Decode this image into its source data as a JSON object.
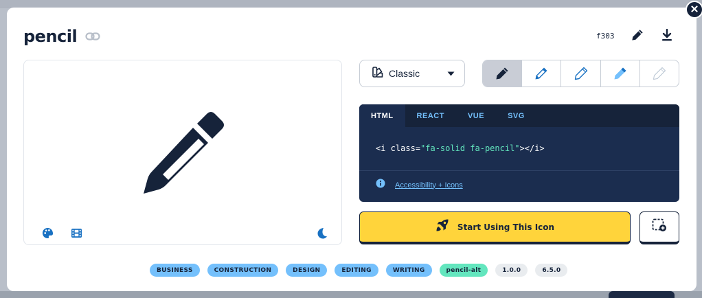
{
  "modal": {
    "title": "pencil",
    "unicode": "f303"
  },
  "style_dropdown": {
    "selected": "Classic"
  },
  "code": {
    "tabs": [
      "HTML",
      "REACT",
      "VUE",
      "SVG"
    ],
    "active_tab": "HTML",
    "snippet_before": "<i class=",
    "snippet_string": "\"fa-solid fa-pencil\"",
    "snippet_after": "></i>",
    "accessibility_link": "Accessibility + Icons"
  },
  "cta": {
    "label": "Start Using This Icon"
  },
  "tags": {
    "categories": [
      "BUSINESS",
      "CONSTRUCTION",
      "DESIGN",
      "EDITING",
      "WRITING"
    ],
    "alias": "pencil-alt",
    "versions": [
      "1.0.0",
      "6.5.0"
    ]
  },
  "icons": {
    "close": "close-icon",
    "link": "link-icon",
    "edit": "pencil-edit-icon",
    "download": "download-icon",
    "palette": "palette-icon",
    "film": "film-icon",
    "moon": "moon-icon",
    "style": "swatchbook-icon",
    "chevron": "caret-down-icon",
    "info": "info-icon",
    "rocket": "rocket-icon",
    "kit": "add-to-kit-icon"
  },
  "colors": {
    "navy": "#16233a",
    "accent_blue": "#1971c2",
    "light_blue": "#74c0fc",
    "yellow": "#ffd43b",
    "teal": "#63e6be"
  }
}
